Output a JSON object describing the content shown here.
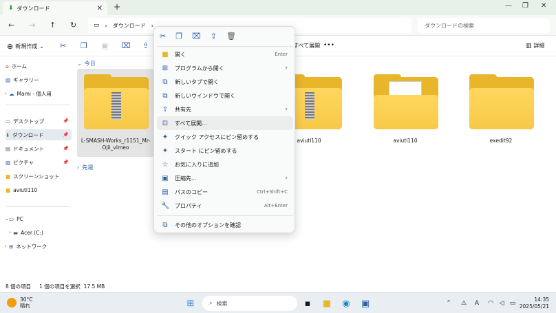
{
  "window": {
    "tab_title": "ダウンロード",
    "minimize": "—",
    "maximize": "❐",
    "close": "✕"
  },
  "address": {
    "crumb": "ダウンロード",
    "search_placeholder": "ダウンロードの検索"
  },
  "toolbar": {
    "new_label": "新規作成",
    "extract_all_label": "すべて展開",
    "more_label": "•••",
    "details_label": "詳細"
  },
  "sidebar": {
    "items": [
      {
        "label": "ホーム"
      },
      {
        "label": "ギャラリー"
      },
      {
        "label": "Mami - 個人用"
      },
      {
        "label": "デスクトップ"
      },
      {
        "label": "ダウンロード"
      },
      {
        "label": "ドキュメント"
      },
      {
        "label": "ピクチャ"
      },
      {
        "label": "スクリーンショット"
      },
      {
        "label": "aviutl110"
      },
      {
        "label": "PC"
      },
      {
        "label": "Acer (C:)"
      },
      {
        "label": "ネットワーク"
      }
    ]
  },
  "content": {
    "group_today": "今日",
    "group_earlier": "先週",
    "items": [
      {
        "label": "L-SMASH-Works_r1151_Mr-Ojii_vimeo",
        "selected": true
      },
      {
        "label": "aviutl110"
      },
      {
        "label": "aviutl110"
      },
      {
        "label": "exedit92"
      }
    ]
  },
  "context_menu": {
    "items": [
      {
        "label": "開く",
        "shortcut": "Enter"
      },
      {
        "label": "プログラムから開く",
        "submenu": true
      },
      {
        "label": "新しいタブで開く"
      },
      {
        "label": "新しいウインドウで開く"
      },
      {
        "label": "共有先",
        "submenu": true
      },
      {
        "label": "すべて展開...",
        "highlighted": true
      },
      {
        "label": "クイック アクセスにピン留めする"
      },
      {
        "label": "スタート にピン留めする"
      },
      {
        "label": "お気に入りに追加"
      },
      {
        "label": "圧縮先...",
        "submenu": true
      },
      {
        "label": "パスのコピー",
        "shortcut": "Ctrl+Shift+C"
      },
      {
        "label": "プロパティ",
        "shortcut": "Alt+Enter"
      },
      {
        "label": "その他のオプションを確認"
      }
    ]
  },
  "status": {
    "item_count": "8 個の項目",
    "selection": "1 個の項目を選択  17.5 MB"
  },
  "taskbar": {
    "temperature": "30°C",
    "weather": "晴れ",
    "search_placeholder": "検索",
    "time": "14:35",
    "date": "2025/05/21",
    "ime": "A"
  },
  "colors": {
    "accent": "#2b5fa8",
    "folder": "#f7c948",
    "selection": "#e4e4e4"
  }
}
